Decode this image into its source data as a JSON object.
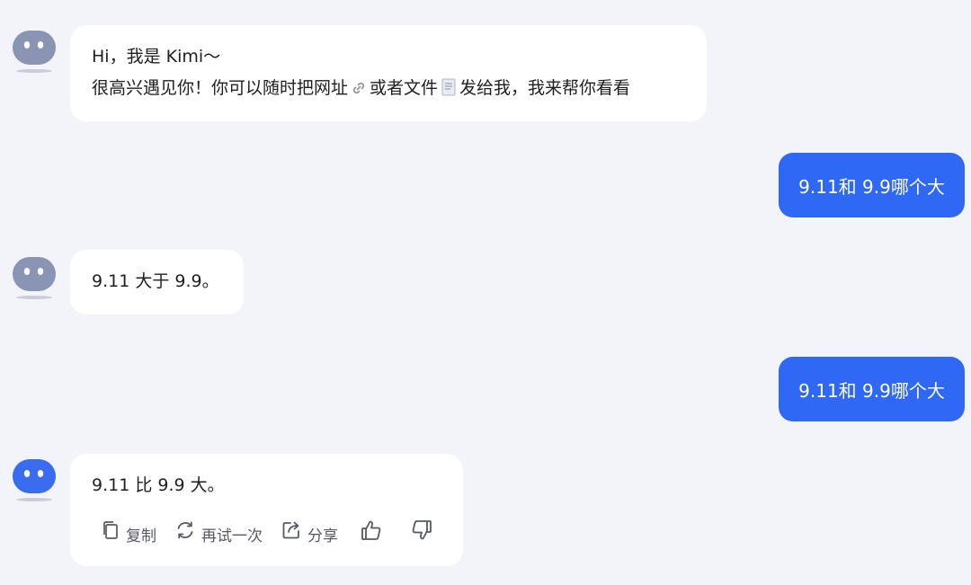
{
  "messages": {
    "greeting": {
      "line1": "Hi，我是 Kimi～",
      "line2_part1": "很高兴遇见你！你可以随时把网址",
      "link_icon": "link-icon",
      "line2_part2": "或者文件",
      "file_icon": "file-icon",
      "line2_part3": "发给我，我来帮你看看"
    },
    "user_question_1": "9.11和 9.9哪个大",
    "bot_answer_1": "9.11 大于 9.9。",
    "user_question_2": "9.11和 9.9哪个大",
    "bot_answer_2": "9.11 比 9.9 大。"
  },
  "actions": {
    "copy_label": "复制",
    "retry_label": "再试一次",
    "share_label": "分享",
    "icons": [
      "copy-icon",
      "refresh-icon",
      "share-icon",
      "thumbs-up-icon",
      "thumbs-down-icon"
    ]
  },
  "colors": {
    "background": "#f3f4fa",
    "user_bubble": "#2f68f5",
    "bot_bubble": "#ffffff",
    "avatar_inactive": "#8a94b3",
    "avatar_active": "#3a6cf0"
  }
}
